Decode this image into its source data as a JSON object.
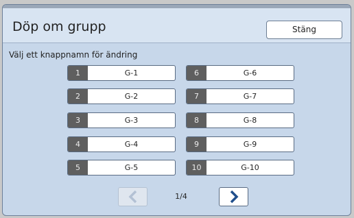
{
  "dialog": {
    "title": "Döp om grupp",
    "close_label": "Stäng",
    "instruction": "Välj ett knappnamn för ändring"
  },
  "groups": [
    {
      "number": "1",
      "name": "G-1"
    },
    {
      "number": "2",
      "name": "G-2"
    },
    {
      "number": "3",
      "name": "G-3"
    },
    {
      "number": "4",
      "name": "G-4"
    },
    {
      "number": "5",
      "name": "G-5"
    },
    {
      "number": "6",
      "name": "G-6"
    },
    {
      "number": "7",
      "name": "G-7"
    },
    {
      "number": "8",
      "name": "G-8"
    },
    {
      "number": "9",
      "name": "G-9"
    },
    {
      "number": "10",
      "name": "G-10"
    }
  ],
  "pagination": {
    "indicator": "1/4",
    "prev_icon": "chevron-left-icon",
    "next_icon": "chevron-right-icon",
    "prev_enabled": false,
    "next_enabled": true
  },
  "colors": {
    "accent": "#1f4e8c",
    "dialog_bg": "#c7d7ea",
    "header_bg": "#d8e4f2",
    "number_badge": "#5f5f5f",
    "disabled_icon": "#b3c1d4"
  }
}
